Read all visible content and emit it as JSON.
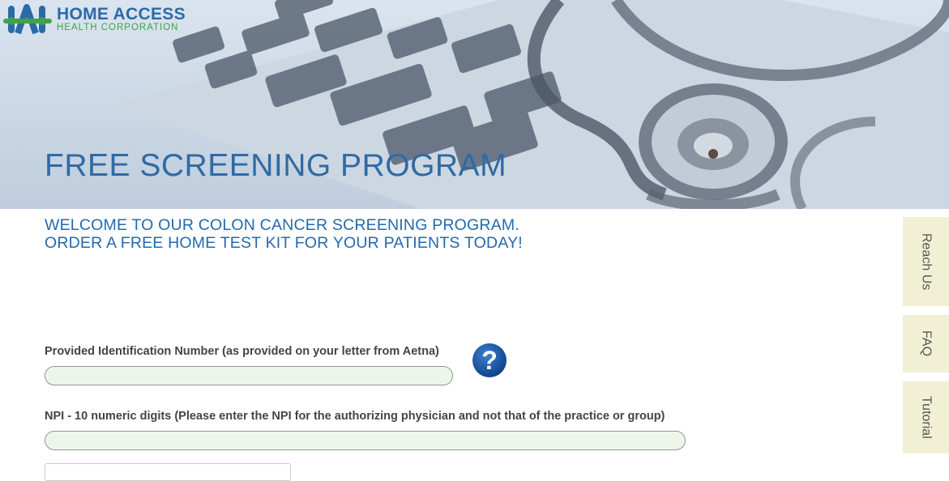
{
  "brand": {
    "name": "HOME ACCESS",
    "subtitle": "HEALTH CORPORATION"
  },
  "hero": {
    "title": "FREE SCREENING PROGRAM"
  },
  "welcome": {
    "line1": "WELCOME TO OUR COLON CANCER SCREENING PROGRAM.",
    "line2": "ORDER A FREE HOME TEST KIT FOR YOUR PATIENTS TODAY!"
  },
  "form": {
    "id_label": "Provided Identification Number (as provided on your letter from Aetna)",
    "id_value": "",
    "npi_label": "NPI - 10 numeric digits (Please enter the NPI for the authorizing physician and not that of the practice or group)",
    "npi_value": ""
  },
  "side_tabs": [
    "Reach Us",
    "FAQ",
    "Tutorial"
  ],
  "colors": {
    "brand_blue": "#2f6aa3",
    "brand_green": "#3ea24a",
    "input_bg": "#eef6ec",
    "tab_bg": "#f1f0d4"
  }
}
